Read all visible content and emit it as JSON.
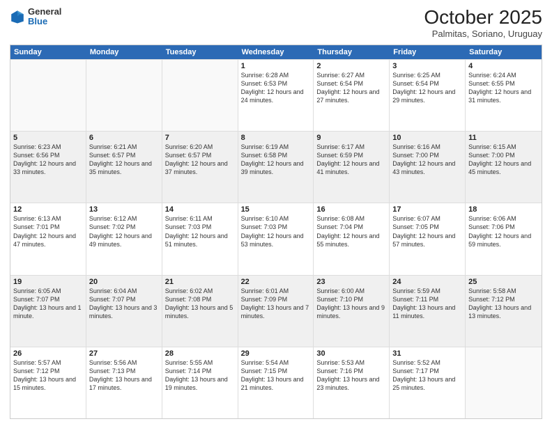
{
  "logo": {
    "general": "General",
    "blue": "Blue"
  },
  "header": {
    "month": "October 2025",
    "location": "Palmitas, Soriano, Uruguay"
  },
  "days": [
    "Sunday",
    "Monday",
    "Tuesday",
    "Wednesday",
    "Thursday",
    "Friday",
    "Saturday"
  ],
  "rows": [
    [
      {
        "day": "",
        "text": "",
        "empty": true
      },
      {
        "day": "",
        "text": "",
        "empty": true
      },
      {
        "day": "",
        "text": "",
        "empty": true
      },
      {
        "day": "1",
        "text": "Sunrise: 6:28 AM\nSunset: 6:53 PM\nDaylight: 12 hours\nand 24 minutes."
      },
      {
        "day": "2",
        "text": "Sunrise: 6:27 AM\nSunset: 6:54 PM\nDaylight: 12 hours\nand 27 minutes."
      },
      {
        "day": "3",
        "text": "Sunrise: 6:25 AM\nSunset: 6:54 PM\nDaylight: 12 hours\nand 29 minutes."
      },
      {
        "day": "4",
        "text": "Sunrise: 6:24 AM\nSunset: 6:55 PM\nDaylight: 12 hours\nand 31 minutes."
      }
    ],
    [
      {
        "day": "5",
        "text": "Sunrise: 6:23 AM\nSunset: 6:56 PM\nDaylight: 12 hours\nand 33 minutes."
      },
      {
        "day": "6",
        "text": "Sunrise: 6:21 AM\nSunset: 6:57 PM\nDaylight: 12 hours\nand 35 minutes."
      },
      {
        "day": "7",
        "text": "Sunrise: 6:20 AM\nSunset: 6:57 PM\nDaylight: 12 hours\nand 37 minutes."
      },
      {
        "day": "8",
        "text": "Sunrise: 6:19 AM\nSunset: 6:58 PM\nDaylight: 12 hours\nand 39 minutes."
      },
      {
        "day": "9",
        "text": "Sunrise: 6:17 AM\nSunset: 6:59 PM\nDaylight: 12 hours\nand 41 minutes."
      },
      {
        "day": "10",
        "text": "Sunrise: 6:16 AM\nSunset: 7:00 PM\nDaylight: 12 hours\nand 43 minutes."
      },
      {
        "day": "11",
        "text": "Sunrise: 6:15 AM\nSunset: 7:00 PM\nDaylight: 12 hours\nand 45 minutes."
      }
    ],
    [
      {
        "day": "12",
        "text": "Sunrise: 6:13 AM\nSunset: 7:01 PM\nDaylight: 12 hours\nand 47 minutes."
      },
      {
        "day": "13",
        "text": "Sunrise: 6:12 AM\nSunset: 7:02 PM\nDaylight: 12 hours\nand 49 minutes."
      },
      {
        "day": "14",
        "text": "Sunrise: 6:11 AM\nSunset: 7:03 PM\nDaylight: 12 hours\nand 51 minutes."
      },
      {
        "day": "15",
        "text": "Sunrise: 6:10 AM\nSunset: 7:03 PM\nDaylight: 12 hours\nand 53 minutes."
      },
      {
        "day": "16",
        "text": "Sunrise: 6:08 AM\nSunset: 7:04 PM\nDaylight: 12 hours\nand 55 minutes."
      },
      {
        "day": "17",
        "text": "Sunrise: 6:07 AM\nSunset: 7:05 PM\nDaylight: 12 hours\nand 57 minutes."
      },
      {
        "day": "18",
        "text": "Sunrise: 6:06 AM\nSunset: 7:06 PM\nDaylight: 12 hours\nand 59 minutes."
      }
    ],
    [
      {
        "day": "19",
        "text": "Sunrise: 6:05 AM\nSunset: 7:07 PM\nDaylight: 13 hours\nand 1 minute."
      },
      {
        "day": "20",
        "text": "Sunrise: 6:04 AM\nSunset: 7:07 PM\nDaylight: 13 hours\nand 3 minutes."
      },
      {
        "day": "21",
        "text": "Sunrise: 6:02 AM\nSunset: 7:08 PM\nDaylight: 13 hours\nand 5 minutes."
      },
      {
        "day": "22",
        "text": "Sunrise: 6:01 AM\nSunset: 7:09 PM\nDaylight: 13 hours\nand 7 minutes."
      },
      {
        "day": "23",
        "text": "Sunrise: 6:00 AM\nSunset: 7:10 PM\nDaylight: 13 hours\nand 9 minutes."
      },
      {
        "day": "24",
        "text": "Sunrise: 5:59 AM\nSunset: 7:11 PM\nDaylight: 13 hours\nand 11 minutes."
      },
      {
        "day": "25",
        "text": "Sunrise: 5:58 AM\nSunset: 7:12 PM\nDaylight: 13 hours\nand 13 minutes."
      }
    ],
    [
      {
        "day": "26",
        "text": "Sunrise: 5:57 AM\nSunset: 7:12 PM\nDaylight: 13 hours\nand 15 minutes."
      },
      {
        "day": "27",
        "text": "Sunrise: 5:56 AM\nSunset: 7:13 PM\nDaylight: 13 hours\nand 17 minutes."
      },
      {
        "day": "28",
        "text": "Sunrise: 5:55 AM\nSunset: 7:14 PM\nDaylight: 13 hours\nand 19 minutes."
      },
      {
        "day": "29",
        "text": "Sunrise: 5:54 AM\nSunset: 7:15 PM\nDaylight: 13 hours\nand 21 minutes."
      },
      {
        "day": "30",
        "text": "Sunrise: 5:53 AM\nSunset: 7:16 PM\nDaylight: 13 hours\nand 23 minutes."
      },
      {
        "day": "31",
        "text": "Sunrise: 5:52 AM\nSunset: 7:17 PM\nDaylight: 13 hours\nand 25 minutes."
      },
      {
        "day": "",
        "text": "",
        "empty": true
      }
    ]
  ]
}
